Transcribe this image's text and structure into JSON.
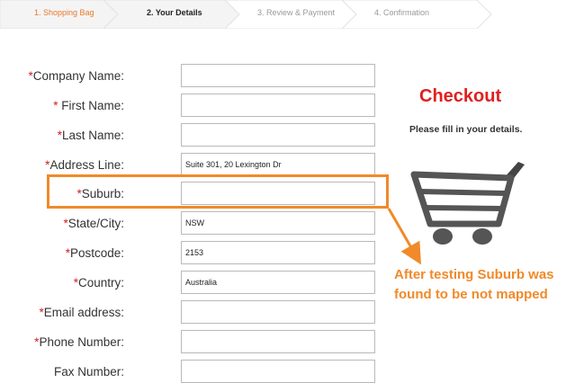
{
  "steps": [
    {
      "label": "1. Shopping Bag",
      "state": "done"
    },
    {
      "label": "2. Your Details",
      "state": "active"
    },
    {
      "label": "3. Review & Payment",
      "state": "upcoming"
    },
    {
      "label": "4. Confirmation",
      "state": "upcoming"
    }
  ],
  "form": {
    "fields": [
      {
        "required": "*",
        "label": "Company Name:",
        "value": ""
      },
      {
        "required": "* ",
        "label": "First Name:",
        "value": ""
      },
      {
        "required": "*",
        "label": "Last Name:",
        "value": ""
      },
      {
        "required": "*",
        "label": "Address Line:",
        "value": "Suite 301, 20 Lexington Dr"
      },
      {
        "required": "*",
        "label": "Suburb:",
        "value": ""
      },
      {
        "required": "*",
        "label": "State/City:",
        "value": "NSW"
      },
      {
        "required": "*",
        "label": "Postcode:",
        "value": "2153"
      },
      {
        "required": "*",
        "label": "Country:",
        "value": "Australia"
      },
      {
        "required": "*",
        "label": "Email address:",
        "value": ""
      },
      {
        "required": "*",
        "label": "Phone Number:",
        "value": ""
      },
      {
        "required": "",
        "label": "Fax Number:",
        "value": ""
      }
    ]
  },
  "panel": {
    "title": "Checkout",
    "subtitle": "Please fill in your details.",
    "icon": "shopping-cart-icon"
  },
  "annotation": {
    "line1": "After testing Suburb was",
    "line2": "found to be not mapped",
    "color": "#f08a2a"
  },
  "colors": {
    "accent": "#e8792b",
    "required": "#d02020",
    "title": "#e02020"
  }
}
